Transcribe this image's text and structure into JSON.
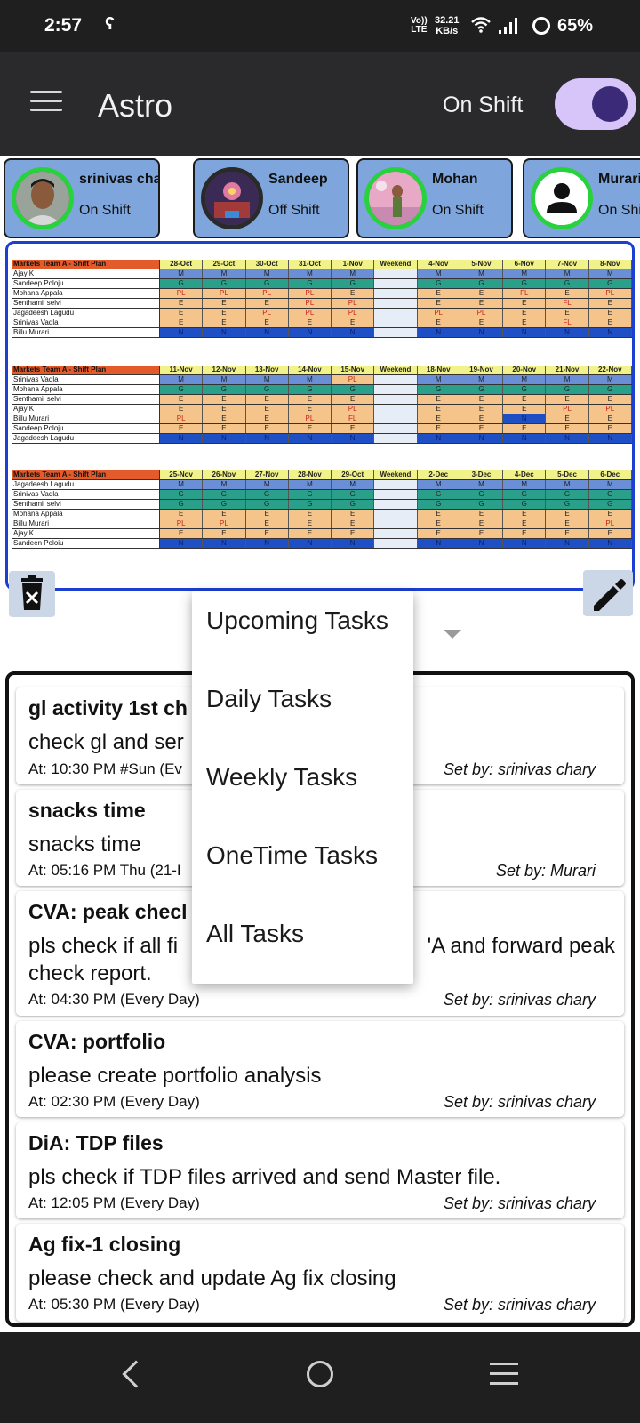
{
  "status_bar": {
    "time": "2:57",
    "volte_line1": "Vo))",
    "volte_line2": "LTE",
    "speed_value": "32.21",
    "speed_unit": "KB/s",
    "battery": "65%"
  },
  "app_bar": {
    "title": "Astro",
    "shift_label": "On Shift",
    "shift_on": true
  },
  "team": [
    {
      "name": "srinivas chary",
      "status": "On Shift"
    },
    {
      "name": "Sandeep",
      "status": "Off Shift"
    },
    {
      "name": "Mohan",
      "status": "On Shift"
    },
    {
      "name": "Murari",
      "status": "On Shift"
    }
  ],
  "schedule": {
    "blocks": [
      {
        "title": "Markets Team A - Shift Plan",
        "dates": [
          "28-Oct",
          "29-Oct",
          "30-Oct",
          "31-Oct",
          "1-Nov",
          "Weekend",
          "4-Nov",
          "5-Nov",
          "6-Nov",
          "7-Nov",
          "8-Nov"
        ],
        "rows": [
          {
            "name": "Ajay K",
            "cells": [
              "M",
              "M",
              "M",
              "M",
              "M",
              "",
              "M",
              "M",
              "M",
              "M",
              "M"
            ]
          },
          {
            "name": "Sandeep Poloju",
            "cells": [
              "G",
              "G",
              "G",
              "G",
              "G",
              "",
              "G",
              "G",
              "G",
              "G",
              "G"
            ]
          },
          {
            "name": "Mohana Appala",
            "cells": [
              "PL",
              "PL",
              "PL",
              "PL",
              "E",
              "",
              "E",
              "E",
              "FL",
              "E",
              "PL"
            ]
          },
          {
            "name": "Senthamil selvi",
            "cells": [
              "E",
              "E",
              "E",
              "PL",
              "PL",
              "",
              "E",
              "E",
              "E",
              "FL",
              "E"
            ]
          },
          {
            "name": "Jagadeesh Lagudu",
            "cells": [
              "E",
              "E",
              "PL",
              "PL",
              "PL",
              "",
              "PL",
              "PL",
              "E",
              "E",
              "E"
            ]
          },
          {
            "name": "Srinivas Vadla",
            "cells": [
              "E",
              "E",
              "E",
              "E",
              "E",
              "",
              "E",
              "E",
              "E",
              "FL",
              "E"
            ]
          },
          {
            "name": "Billu Murari",
            "cells": [
              "N",
              "N",
              "N",
              "N",
              "N",
              "",
              "N",
              "N",
              "N",
              "N",
              "N"
            ]
          }
        ]
      },
      {
        "title": "Markets Team A - Shift Plan",
        "dates": [
          "11-Nov",
          "12-Nov",
          "13-Nov",
          "14-Nov",
          "15-Nov",
          "Weekend",
          "18-Nov",
          "19-Nov",
          "20-Nov",
          "21-Nov",
          "22-Nov"
        ],
        "rows": [
          {
            "name": "Srinivas Vadla",
            "cells": [
              "M",
              "M",
              "M",
              "M",
              "PL",
              "",
              "M",
              "M",
              "M",
              "M",
              "M"
            ]
          },
          {
            "name": "Mohana Appala",
            "cells": [
              "G",
              "G",
              "G",
              "G",
              "G",
              "",
              "G",
              "G",
              "G",
              "G",
              "G"
            ]
          },
          {
            "name": "Senthamil selvi",
            "cells": [
              "E",
              "E",
              "E",
              "E",
              "E",
              "",
              "E",
              "E",
              "E",
              "E",
              "E"
            ]
          },
          {
            "name": "Ajay K",
            "cells": [
              "E",
              "E",
              "E",
              "E",
              "PL",
              "",
              "E",
              "E",
              "E",
              "PL",
              "PL"
            ]
          },
          {
            "name": "Billu Murari",
            "cells": [
              "PL",
              "E",
              "E",
              "PL",
              "FL",
              "",
              "E",
              "E",
              "N",
              "E",
              "E"
            ]
          },
          {
            "name": "Sandeep Poloju",
            "cells": [
              "E",
              "E",
              "E",
              "E",
              "E",
              "",
              "E",
              "E",
              "E",
              "E",
              "E"
            ]
          },
          {
            "name": "Jagadeesh Lagudu",
            "cells": [
              "N",
              "N",
              "N",
              "N",
              "N",
              "",
              "N",
              "N",
              "N",
              "N",
              "N"
            ]
          }
        ]
      },
      {
        "title": "Markets Team A - Shift Plan",
        "dates": [
          "25-Nov",
          "26-Nov",
          "27-Nov",
          "28-Nov",
          "29-Oct",
          "Weekend",
          "2-Dec",
          "3-Dec",
          "4-Dec",
          "5-Dec",
          "6-Dec"
        ],
        "rows": [
          {
            "name": "Jagadeesh Lagudu",
            "cells": [
              "M",
              "M",
              "M",
              "M",
              "M",
              "",
              "M",
              "M",
              "M",
              "M",
              "M"
            ]
          },
          {
            "name": "Srinivas Vadla",
            "cells": [
              "G",
              "G",
              "G",
              "G",
              "G",
              "",
              "G",
              "G",
              "G",
              "G",
              "G"
            ]
          },
          {
            "name": "Senthamil selvi",
            "cells": [
              "G",
              "G",
              "G",
              "G",
              "G",
              "",
              "G",
              "G",
              "G",
              "G",
              "G"
            ]
          },
          {
            "name": "Mohana Appala",
            "cells": [
              "E",
              "E",
              "E",
              "E",
              "E",
              "",
              "E",
              "E",
              "E",
              "E",
              "E"
            ]
          },
          {
            "name": "Billu Murari",
            "cells": [
              "PL",
              "PL",
              "E",
              "E",
              "E",
              "",
              "E",
              "E",
              "E",
              "E",
              "PL"
            ]
          },
          {
            "name": "Ajay K",
            "cells": [
              "E",
              "E",
              "E",
              "E",
              "E",
              "",
              "E",
              "E",
              "E",
              "E",
              "E"
            ]
          },
          {
            "name": "Sandeen Poloiu",
            "cells": [
              "N",
              "N",
              "N",
              "N",
              "N",
              "",
              "N",
              "N",
              "N",
              "N",
              "N"
            ]
          }
        ]
      }
    ]
  },
  "dropdown": {
    "options": [
      "Upcoming Tasks",
      "Daily Tasks",
      "Weekly Tasks",
      "OneTime Tasks",
      "All Tasks"
    ]
  },
  "tasks": [
    {
      "title": "gl activity 1st ch",
      "desc": "check gl and ser",
      "at": "At: 10:30 PM #Sun (Ev",
      "by": "Set by: srinivas chary"
    },
    {
      "title": "snacks time",
      "desc": "snacks time",
      "at": "At: 05:16 PM Thu (21-I",
      "by": "Set by: Murari"
    },
    {
      "title": "CVA: peak checl",
      "desc": "pls check if all fi",
      "desc_tail": "'A and forward peak",
      "desc2": "check report.",
      "at": "At: 04:30 PM (Every Day)",
      "by": "Set by: srinivas chary"
    },
    {
      "title": "CVA: portfolio",
      "desc": "please create portfolio analysis",
      "at": "At: 02:30 PM (Every Day)",
      "by": "Set by: srinivas chary"
    },
    {
      "title": "DiA: TDP files",
      "desc": "pls check if TDP files arrived and send Master file.",
      "at": "At: 12:05 PM (Every Day)",
      "by": "Set by: srinivas chary"
    },
    {
      "title": "Ag fix-1 closing",
      "desc": "please check and update Ag fix closing",
      "at": "At: 05:30 PM (Every Day)",
      "by": "Set by: srinivas chary"
    }
  ],
  "colors": {
    "accent_blue": "#1c3fd1",
    "card_blue": "#7fa6dc",
    "toggle_track": "#d7c4f8",
    "toggle_thumb": "#3b2a77",
    "online_green": "#28d23c"
  }
}
